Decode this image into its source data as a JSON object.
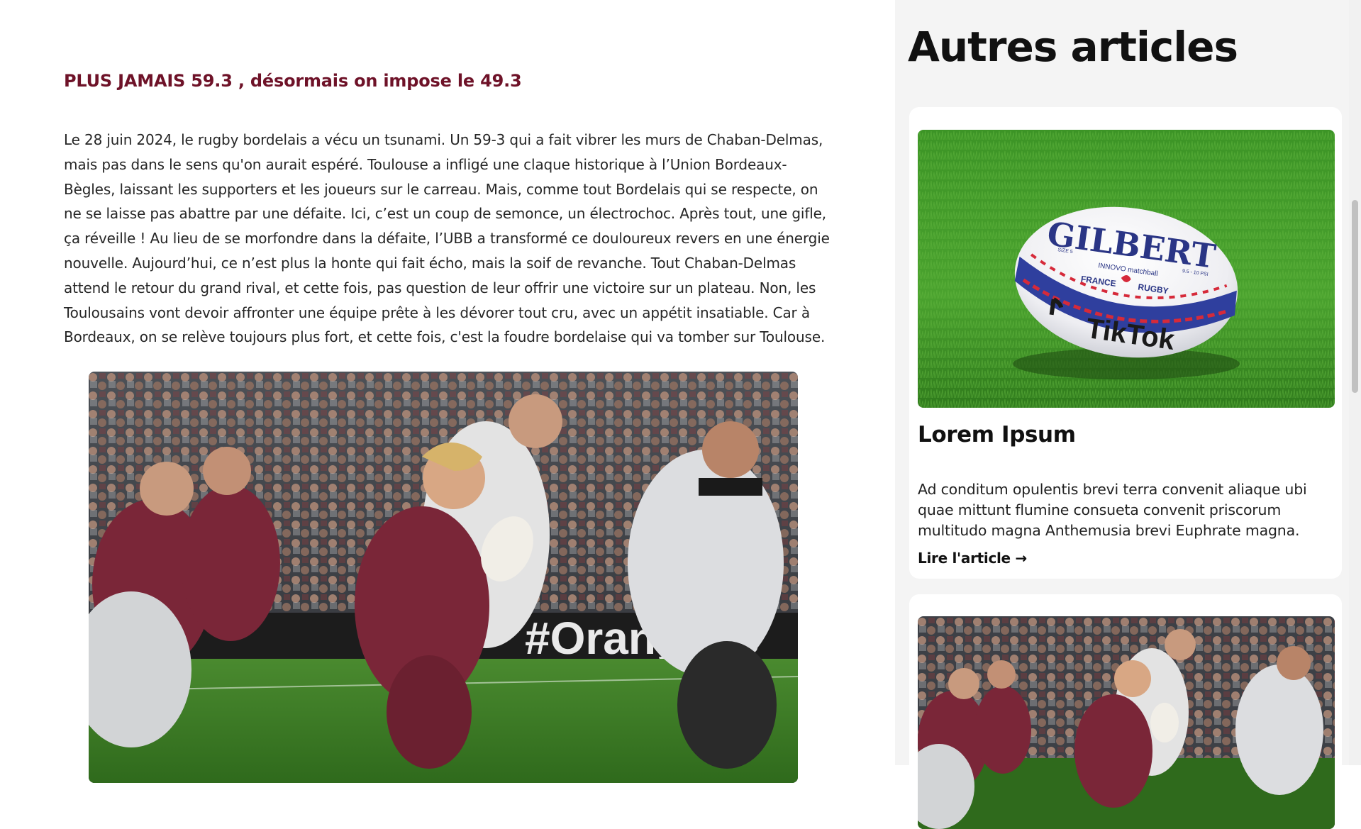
{
  "article": {
    "subtitle": "PLUS JAMAIS 59.3 , désormais on impose le 49.3",
    "body": "Le 28 juin 2024, le rugby bordelais a vécu un tsunami. Un 59-3 qui a fait vibrer les murs de Chaban-Delmas, mais pas dans le sens qu'on aurait espéré. Toulouse a infligé une claque historique à l’Union Bordeaux-Bègles, laissant les supporters et les joueurs sur le carreau. Mais, comme tout Bordelais qui se respecte, on ne se laisse pas abattre par une défaite. Ici, c’est un coup de semonce, un électrochoc. Après tout, une gifle, ça réveille ! Au lieu de se morfondre dans la défaite, l’UBB a transformé ce douloureux revers en une énergie nouvelle. Aujourd’hui, ce n’est plus la honte qui fait écho, mais la soif de revanche. Tout Chaban-Delmas attend le retour du grand rival, et cette fois, pas question de leur offrir une victoire sur un plateau. Non, les Toulousains vont devoir affronter une équipe prête à les dévorer tout cru, avec un appétit insatiable. Car à Bordeaux, on se relève toujours plus fort, et cette fois, c'est la foudre bordelaise qui va tomber sur Toulouse.",
    "image_banner_text": "#Orangeas"
  },
  "sidebar": {
    "title": "Autres articles",
    "cards": [
      {
        "title": "Lorem Ipsum",
        "text": "Ad conditum opulentis brevi terra convenit aliaque ubi quae mittunt flumine consueta convenit priscorum multitudo magna Anthemusia brevi Euphrate magna.",
        "link_label": "Lire l'article →",
        "ball_brand": "GILBERT",
        "ball_line1": "INNOVO matchball",
        "ball_line2": "FRANCE",
        "ball_line3": "RUGBY",
        "ball_sponsor": "TikTok",
        "ball_size": "SIZE 5",
        "ball_psi": "9.5 - 10 PSI"
      },
      {
        "title": "",
        "text": "",
        "link_label": ""
      }
    ]
  },
  "colors": {
    "accent": "#6e1228",
    "ubb_maroon": "#7a2638",
    "sidebar_bg": "#f4f4f4",
    "grass": "#3f8a2a"
  }
}
